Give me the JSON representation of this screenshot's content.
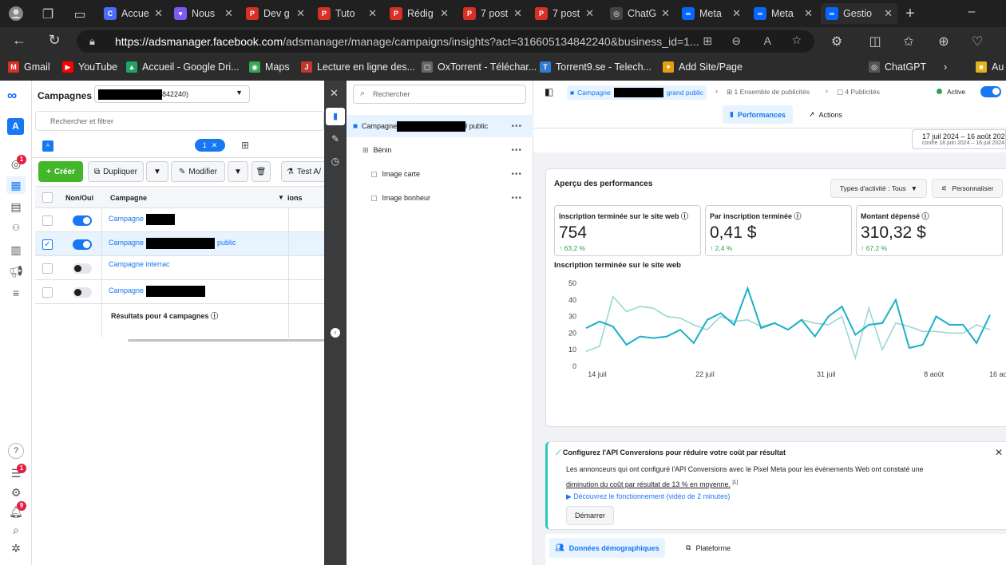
{
  "browser": {
    "tabs": [
      {
        "label": "Accue",
        "icon": "copilot-icon",
        "color": "#4b6bfb"
      },
      {
        "label": "Nous",
        "icon": "heart-icon",
        "color": "#7d5bf2"
      },
      {
        "label": "Dev g",
        "icon": "pdf-icon",
        "color": "#d93025"
      },
      {
        "label": "Tuto",
        "icon": "pdf-icon",
        "color": "#d93025"
      },
      {
        "label": "Rédig",
        "icon": "pdf-icon",
        "color": "#d93025"
      },
      {
        "label": "7 post",
        "icon": "pdf-icon",
        "color": "#d93025"
      },
      {
        "label": "7 post",
        "icon": "pdf-icon",
        "color": "#d93025"
      },
      {
        "label": "ChatG",
        "icon": "chatgpt-icon",
        "color": "#444"
      },
      {
        "label": "Meta",
        "icon": "meta-icon",
        "color": "#0866ff"
      },
      {
        "label": "Meta",
        "icon": "meta-icon",
        "color": "#0866ff"
      },
      {
        "label": "Gestio",
        "icon": "meta-icon",
        "color": "#0866ff"
      }
    ],
    "url_domain": "https://adsmanager.facebook.com",
    "url_path": "/adsmanager/manage/campaigns/insights?act=316605134842240&business_id=1...",
    "bookmarks": [
      {
        "label": "Gmail",
        "color": "#d93025",
        "glyph": "M"
      },
      {
        "label": "YouTube",
        "color": "#ff0000",
        "glyph": "▶"
      },
      {
        "label": "Accueil - Google Dri...",
        "color": "#1fa463",
        "glyph": "▲"
      },
      {
        "label": "Maps",
        "color": "#34a853",
        "glyph": "◉"
      },
      {
        "label": "Lecture en ligne des...",
        "color": "#c0392b",
        "glyph": "J"
      },
      {
        "label": "OxTorrent - Téléchar...",
        "color": "#666",
        "glyph": "▢"
      },
      {
        "label": "Torrent9.se - Telech...",
        "color": "#2f7dd1",
        "glyph": "T"
      },
      {
        "label": "Add Site/Page",
        "color": "#e5a00d",
        "glyph": "✦"
      },
      {
        "label": "ChatGPT",
        "color": "#555",
        "glyph": "◎"
      },
      {
        "label": "Au",
        "color": "#e5b21b",
        "glyph": "■"
      }
    ]
  },
  "nav": {
    "account_initial": "A",
    "badge_1": "1",
    "badge_2": "1",
    "badge_3": "9"
  },
  "campaigns": {
    "title": "Campagnes",
    "account_suffix": "842240)",
    "search_placeholder": "Rechercher et filtrer",
    "selected_count": "1",
    "selected_close": "✕",
    "btn_create": "Créer",
    "btn_duplicate": "Dupliquer",
    "btn_edit": "Modifier",
    "btn_test": "Test A/",
    "col_onoff": "Non/Oui",
    "col_campaign": "Campagne",
    "col_more": "ions",
    "rows": [
      {
        "name": "Campagne",
        "suffix": "",
        "on": true,
        "checked": false
      },
      {
        "name": "Campagne",
        "suffix": "public",
        "on": true,
        "checked": true
      },
      {
        "name": "Campagne interrac",
        "suffix": "",
        "on": false,
        "checked": false
      },
      {
        "name": "Campagne",
        "suffix": "",
        "on": false,
        "checked": false
      }
    ],
    "results": "Résultats pour 4 campagnes"
  },
  "tree": {
    "search_placeholder": "Rechercher",
    "campaign_prefix": "Campagne",
    "campaign_suffix": "ł public",
    "adset": "Bénin",
    "ads": [
      "Image carte",
      "Image bonheur"
    ]
  },
  "detail": {
    "crumb_campaign": "Campagne",
    "crumb_campaign_suffix": "grand public",
    "crumb_adsets": "1 Ensemble de publicités",
    "crumb_ads": "4 Publicités",
    "status": "Active",
    "tab_performance": "Performances",
    "tab_actions": "Actions",
    "date_range": "17 juil 2024 – 16 août 2024",
    "date_compare": "contre 16 juin 2024 – 16 juil 2024",
    "overview_title": "Aperçu des performances",
    "activity_filter": "Types d'activité : Tous",
    "customize": "Personnaliser",
    "kpis": [
      {
        "label": "Inscription terminée sur le site web",
        "value": "754",
        "change": "63,2 %"
      },
      {
        "label": "Par inscription terminée",
        "value": "0,41 $",
        "change": "2,4 %"
      },
      {
        "label": "Montant dépensé",
        "value": "310,32 $",
        "change": "67,2 %"
      }
    ],
    "chart_title": "Inscription terminée sur le site web",
    "banner_title": "Configurez l'API Conversions pour réduire votre coût par résultat",
    "banner_text": "Les annonceurs qui ont configuré l'API Conversions avec le Pixel Meta pour les évènements Web ont constaté une",
    "banner_link": "diminution du coût par résultat de 13 % en moyenne.",
    "banner_sup": "[1]",
    "banner_video": "Découvrez le fonctionnement (vidéo de 2 minutes)",
    "banner_button": "Démarrer",
    "bottom_tab_1": "Données démographiques",
    "bottom_tab_2": "Plateforme"
  },
  "chart_data": {
    "type": "line",
    "title": "Inscription terminée sur le site web",
    "x_tick_labels": [
      "14 juil",
      "22 juil",
      "31 juil",
      "8 août",
      "16 août"
    ],
    "y_ticks": [
      0,
      10,
      20,
      30,
      40,
      50
    ],
    "ylim": [
      0,
      50
    ],
    "series": [
      {
        "color": "#1ab0c6",
        "values": [
          23,
          27,
          24,
          13,
          18,
          17,
          18,
          22,
          14,
          28,
          32,
          25,
          47,
          23,
          26,
          22,
          28,
          18,
          30,
          36,
          19,
          25,
          26,
          40,
          11,
          13,
          30,
          25,
          25,
          14,
          31
        ]
      },
      {
        "color": "#9ad8d4",
        "values": [
          9,
          12,
          42,
          33,
          36,
          35,
          30,
          29,
          25,
          22,
          30,
          27,
          28,
          24,
          26,
          22,
          28,
          26,
          25,
          30,
          5,
          35,
          10,
          26,
          24,
          21,
          21,
          20,
          20,
          25,
          22
        ]
      }
    ]
  }
}
